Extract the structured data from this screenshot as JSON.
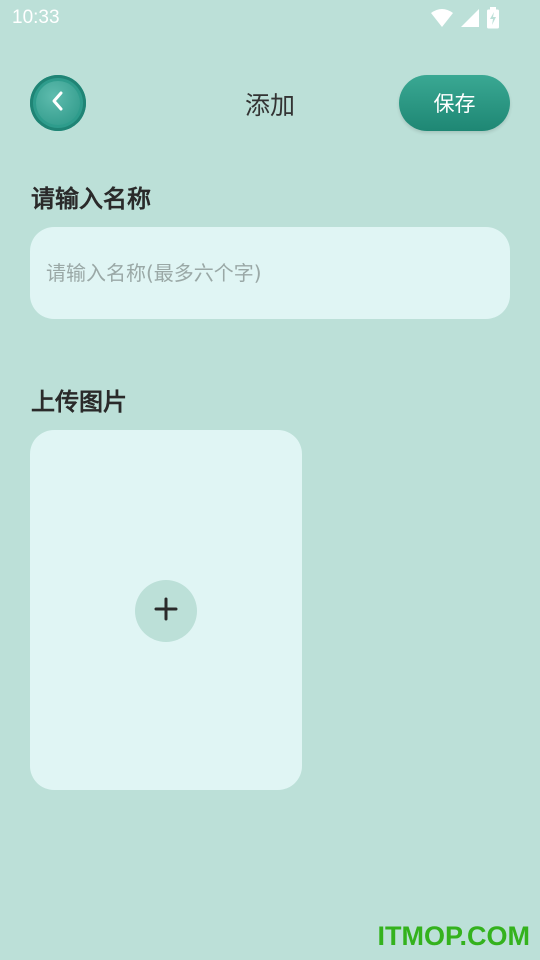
{
  "status_bar": {
    "time": "10:33",
    "icons": [
      "wifi-icon",
      "signal-icon",
      "battery-charging-icon"
    ]
  },
  "header": {
    "back_icon": "chevron-left-icon",
    "title": "添加",
    "save_label": "保存"
  },
  "name_section": {
    "label": "请输入名称",
    "input_value": "",
    "placeholder": "请输入名称(最多六个字)"
  },
  "upload_section": {
    "label": "上传图片",
    "add_icon": "plus-icon"
  },
  "watermark": {
    "text": "ITMOP.COM"
  },
  "colors": {
    "background": "#bce0d8",
    "accent": "#2a9686",
    "card": "#e0f5f4",
    "watermark": "#34b21d"
  }
}
